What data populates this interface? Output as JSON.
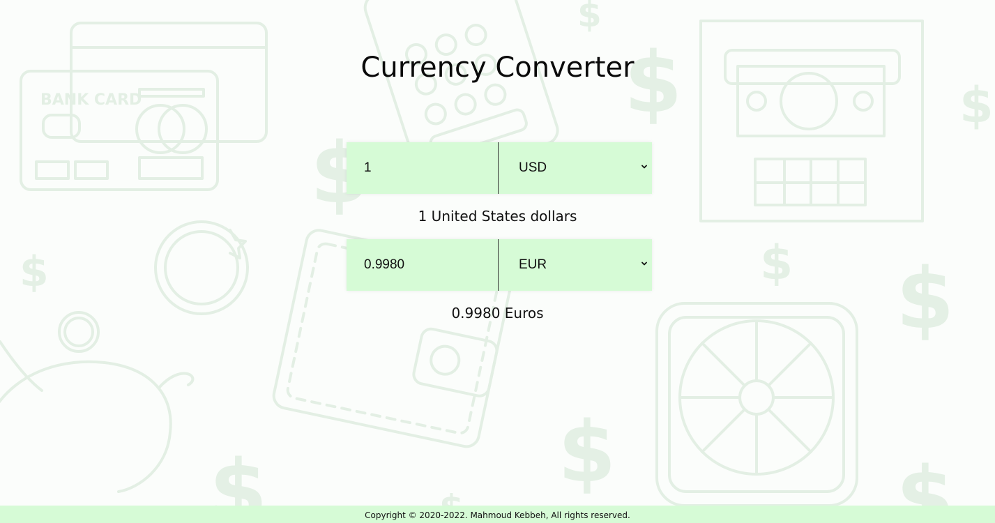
{
  "title": "Currency Converter",
  "from": {
    "amount": "1",
    "currency": "USD",
    "description": "1 United States dollars"
  },
  "to": {
    "amount": "0.9980",
    "currency": "EUR",
    "description": "0.9980 Euros"
  },
  "background": {
    "card_text": "BANK CARD"
  },
  "footer": {
    "copyright": "Copyright © 2020-2022. Mahmoud Kebbeh, All rights reserved."
  },
  "colors": {
    "field_background": "#d6fbd6",
    "footer_background": "#d6fbd6",
    "decor_stroke": "#e3efe4"
  }
}
